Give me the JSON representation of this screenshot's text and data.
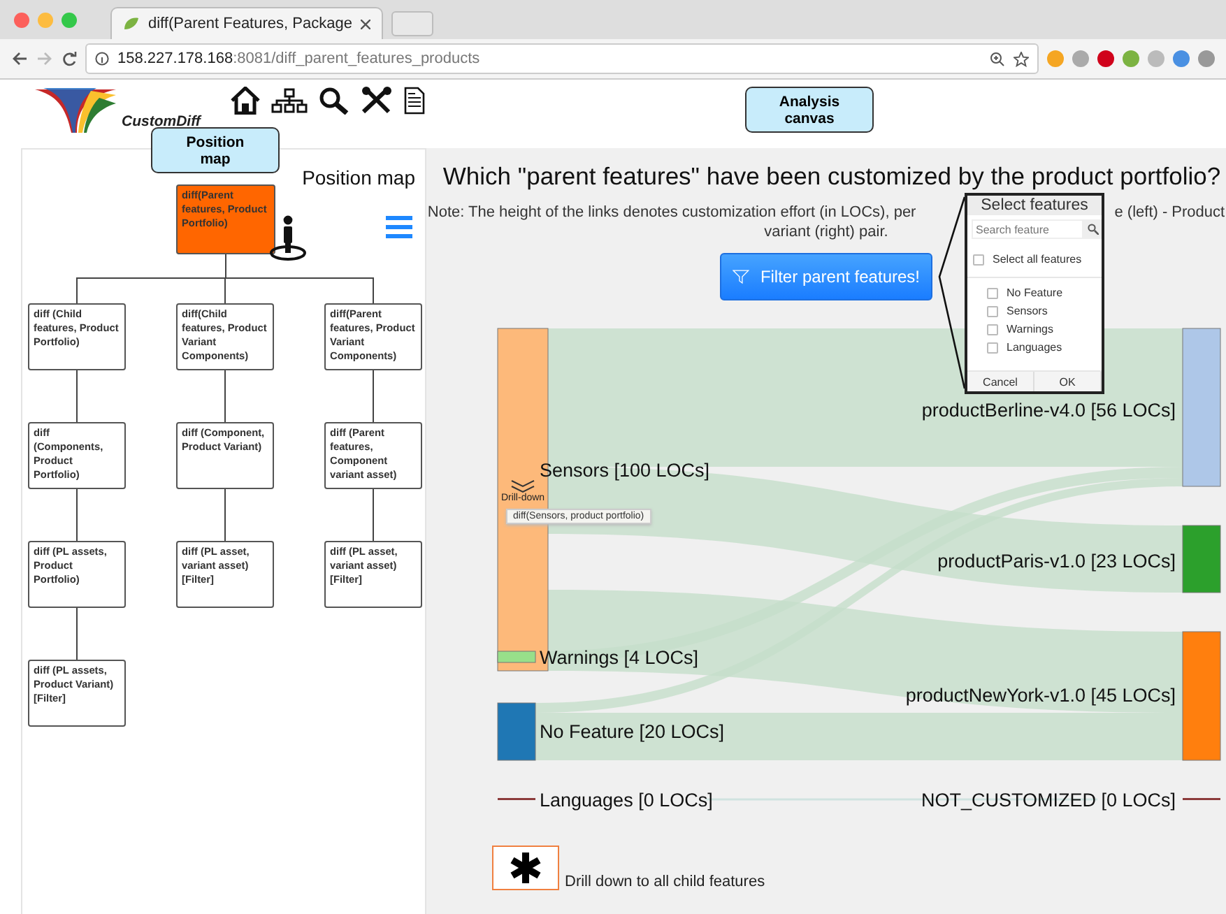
{
  "browser": {
    "tab_title": "diff(Parent Features, Package",
    "url_host": "158.227.178.168",
    "url_path": ":8081/diff_parent_features_products"
  },
  "app": {
    "logo_text": "CustomDiff"
  },
  "callouts": [
    {
      "text": "Position map"
    },
    {
      "text": "Analysis canvas"
    }
  ],
  "position_map": {
    "title": "Position map",
    "root": {
      "label": "diff(Parent features, Product Portfolio)",
      "selected": true,
      "children": [
        {
          "label": "diff (Child features, Product Portfolio)",
          "selected": false,
          "children": [
            {
              "label": "diff (Components, Product Portfolio)",
              "selected": false,
              "children": [
                {
                  "label": "diff (PL assets, Product Portfolio)",
                  "selected": false,
                  "children": [
                    {
                      "label": "diff (PL assets, Product Variant) [Filter]",
                      "selected": false
                    }
                  ]
                }
              ]
            }
          ]
        },
        {
          "label": "diff(Child features, Product Variant Components)",
          "selected": false,
          "children": [
            {
              "label": "diff (Component, Product Variant)",
              "selected": false,
              "children": [
                {
                  "label": "diff (PL asset, variant asset) [Filter]",
                  "selected": false
                }
              ]
            }
          ]
        },
        {
          "label": "diff(Parent features, Product Variant Components)",
          "selected": false,
          "children": [
            {
              "label": "diff (Parent features, Component variant asset)",
              "selected": false,
              "children": [
                {
                  "label": "diff (PL asset, variant asset) [Filter]",
                  "selected": false
                }
              ]
            }
          ]
        }
      ]
    }
  },
  "analysis": {
    "title": "Which \"parent features\" have been customized by the product portfolio?",
    "note_lines": [
      "Note: The height of the links denotes customization effort (in LOCs), per",
      "e (left) - Product",
      "variant (right) pair."
    ],
    "filter_button": "Filter parent features!"
  },
  "feature_filter": {
    "title": "Select features",
    "placeholder": "Search feature",
    "select_all": {
      "label": "Select all features",
      "checked": false
    },
    "items": [
      {
        "label": "No Feature",
        "checked": false
      },
      {
        "label": "Sensors",
        "checked": false
      },
      {
        "label": "Warnings",
        "checked": false
      },
      {
        "label": "Languages",
        "checked": false
      }
    ],
    "buttons": [
      "Cancel",
      "OK"
    ]
  },
  "sankey": {
    "sources": [
      {
        "label": "Sensors [100 LOCs]",
        "color": "#fdb97a"
      },
      {
        "label": "Warnings [4 LOCs]",
        "color": "#98df8a"
      },
      {
        "label": "No Feature [20 LOCs]",
        "color": "#1f77b4"
      },
      {
        "label": "Languages [0 LOCs]",
        "color": "#8c3b3b"
      }
    ],
    "targets": [
      {
        "label": "productBerline-v4.0 [56 LOCs]",
        "color": "#aec7e8"
      },
      {
        "label": "productParis-v1.0 [23 LOCs]",
        "color": "#2ca02c"
      },
      {
        "label": "productNewYork-v1.0 [45 LOCs]",
        "color": "#ff7f0e"
      },
      {
        "label": "NOT_CUSTOMIZED [0 LOCs]",
        "color": "#8c3b3b"
      }
    ],
    "drill_label": "Drill-down",
    "tooltip": "diff(Sensors, product portfolio)"
  },
  "legend": {
    "text": "Drill down to all child features"
  }
}
